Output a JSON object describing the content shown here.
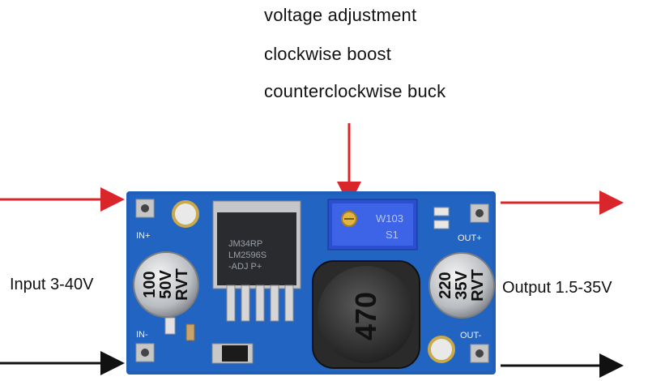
{
  "annotations": {
    "line1": "voltage adjustment",
    "line2": "clockwise  boost",
    "line3": "counterclockwise buck"
  },
  "labels": {
    "input": "Input 3-40V",
    "output": "Output 1.5-35V"
  },
  "board": {
    "in_plus": "IN+",
    "in_minus": "IN-",
    "out_plus": "OUT+",
    "out_minus": "OUT-",
    "chip_line1": "JM34RP",
    "chip_line2": "LM2596S",
    "chip_line3": "-ADJ  P+",
    "inductor_value": "470",
    "cap_in_l1": "100",
    "cap_in_l2": "50V",
    "cap_in_l3": "RVT",
    "cap_out_l1": "220",
    "cap_out_l2": "35V",
    "cap_out_l3": "RVT",
    "pot_l1": "W103",
    "pot_l2": "S1"
  },
  "colors": {
    "arrow_input_positive": "#d9262b",
    "arrow_output_positive": "#d9262b",
    "arrow_input_negative": "#111111",
    "arrow_output_negative": "#111111",
    "annotation_arrow": "#d9262b",
    "pcb": "#1f5fb8",
    "potentiometer": "#2a4fd0"
  }
}
